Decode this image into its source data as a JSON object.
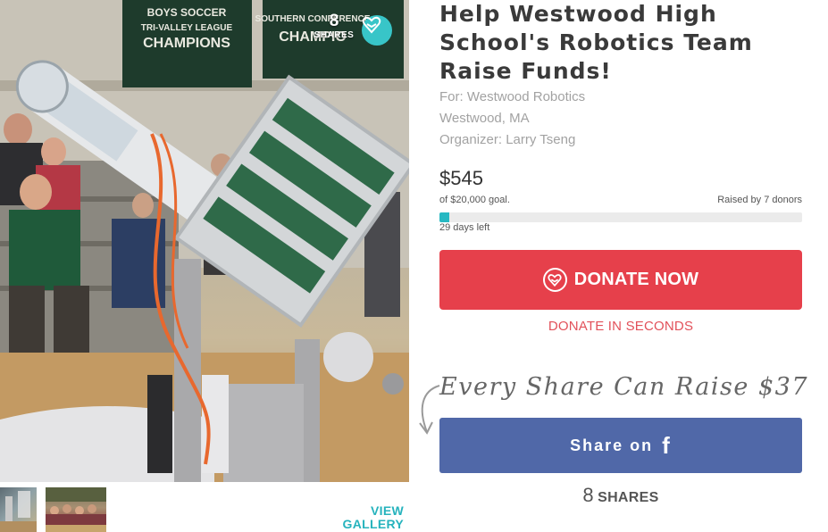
{
  "campaign": {
    "title": "Help Westwood High School's Robotics Team Raise Funds!",
    "for_text": "For: Westwood Robotics",
    "location": "Westwood, MA",
    "organizer": "Organizer: Larry Tseng"
  },
  "photo": {
    "banner_left_line1": "BOYS SOCCER",
    "banner_left_line2": "TRI-VALLEY LEAGUE",
    "banner_left_line3": "CHAMPIONS",
    "banner_right_line1": "SOUTHERN CONFERENCE",
    "banner_right_line2": "CHAMPIO",
    "share_count": "8",
    "share_label": "SHARES",
    "badge_icon": "heart-hand-icon"
  },
  "gallery": {
    "view_label": "VIEW\nGALLERY"
  },
  "funding": {
    "raised": "$545",
    "goal_text": "of $20,000 goal.",
    "donors_text": "Raised by 7 donors",
    "progress_fraction": 0.027,
    "days_left": "29 days left"
  },
  "actions": {
    "donate_label": "DONATE NOW",
    "donate_seconds_label": "DONATE IN SECONDS",
    "share_pitch": "Every Share Can Raise $37",
    "share_fb_label": "Share on",
    "share_fb_icon": "f",
    "share_count": "8",
    "share_count_label": "SHARES"
  },
  "colors": {
    "accent_teal": "#27b8c2",
    "donate_red": "#e6404b",
    "facebook_blue": "#5068a8"
  }
}
